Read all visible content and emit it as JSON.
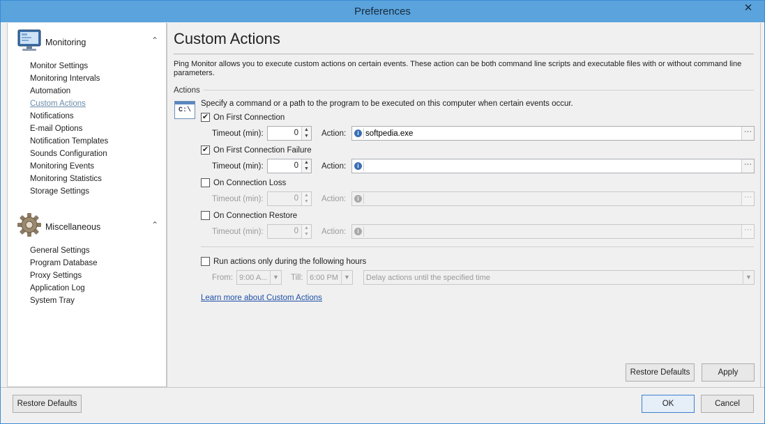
{
  "window": {
    "title": "Preferences",
    "close_glyph": "✕"
  },
  "sidebar": {
    "groups": [
      {
        "label": "Monitoring",
        "icon": "monitor-icon",
        "items": [
          "Monitor Settings",
          "Monitoring Intervals",
          "Automation",
          "Custom Actions",
          "Notifications",
          "E-mail Options",
          "Notification Templates",
          "Sounds Configuration",
          "Monitoring Events",
          "Monitoring Statistics",
          "Storage Settings"
        ]
      },
      {
        "label": "Miscellaneous",
        "icon": "gear-icon",
        "items": [
          "General Settings",
          "Program Database",
          "Proxy Settings",
          "Application Log",
          "System Tray"
        ]
      }
    ],
    "active_item": "Custom Actions",
    "collapse_glyph": "⌃"
  },
  "main": {
    "title": "Custom Actions",
    "description": "Ping Monitor allows you to execute custom actions on certain events. These action can be both command line scripts and executable files with or without command line parameters.",
    "section_label": "Actions",
    "command_icon_text": "C:\\",
    "instruction": "Specify a command or a path to the program to be executed on this computer when certain events occur.",
    "timeout_label": "Timeout (min):",
    "action_label": "Action:",
    "events": [
      {
        "label": "On First Connection",
        "checked": true,
        "timeout": "0",
        "action": "softpedia.exe"
      },
      {
        "label": "On First Connection Failure",
        "checked": true,
        "timeout": "0",
        "action": ""
      },
      {
        "label": "On Connection Loss",
        "checked": false,
        "timeout": "0",
        "action": ""
      },
      {
        "label": "On Connection Restore",
        "checked": false,
        "timeout": "0",
        "action": ""
      }
    ],
    "run_hours": {
      "label": "Run actions only during the following hours",
      "checked": false,
      "from_label": "From:",
      "from_value": "9:00 A...",
      "till_label": "Till:",
      "till_value": "6:00 PM",
      "mode_value": "Delay actions until the specified time"
    },
    "learn_more": "Learn more about Custom Actions",
    "restore_defaults": "Restore Defaults",
    "apply": "Apply"
  },
  "footer": {
    "restore_defaults": "Restore Defaults",
    "ok": "OK",
    "cancel": "Cancel"
  },
  "colors": {
    "titlebar": "#5aa3dd",
    "link": "#1f4fa8",
    "active_nav": "#6a8aa8"
  }
}
